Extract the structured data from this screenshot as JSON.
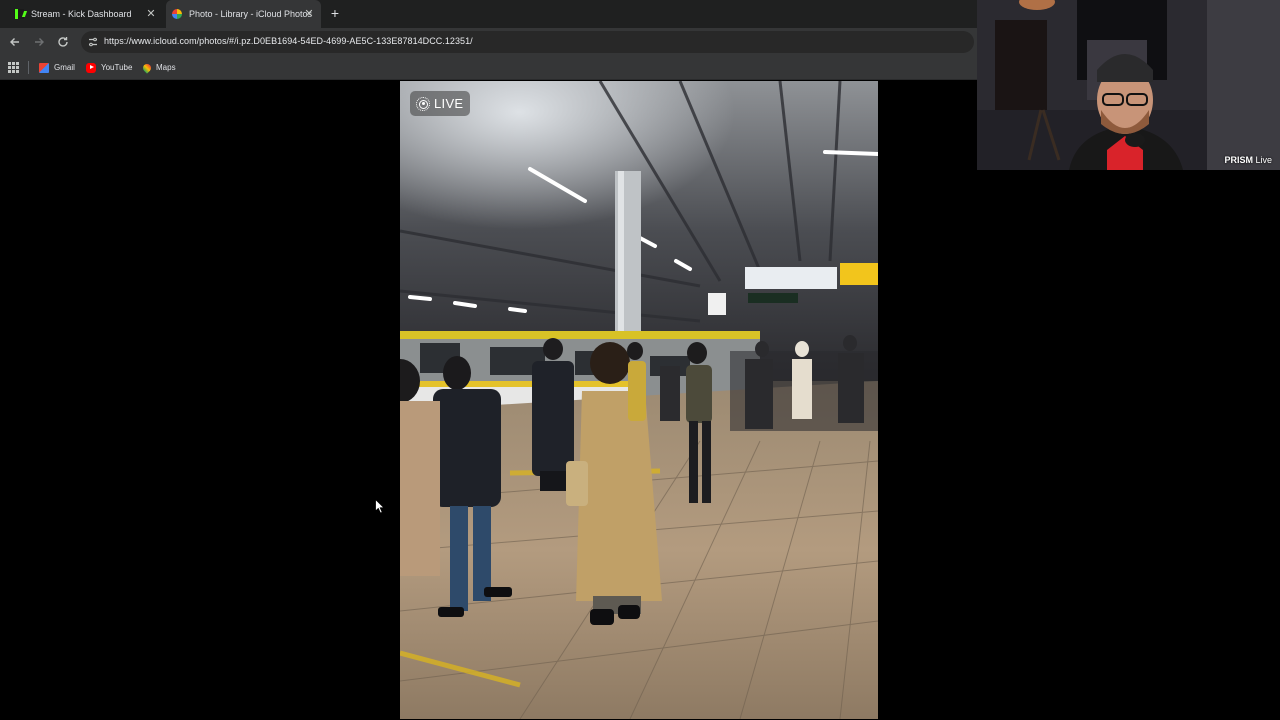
{
  "browser": {
    "tabs": [
      {
        "title": "Stream - Kick Dashboard",
        "favicon": "kick-icon",
        "active": false
      },
      {
        "title": "Photo - Library - iCloud Photos",
        "favicon": "photos-icon",
        "active": true
      }
    ],
    "new_tab_icon": "plus-icon",
    "address": {
      "url": "https://www.icloud.com/photos/#/i.pz.D0EB1694-54ED-4699-AE5C-133E87814DCC.12351/"
    },
    "bookmarks": [
      {
        "label": "Gmail",
        "icon": "gmail-icon"
      },
      {
        "label": "YouTube",
        "icon": "youtube-icon"
      },
      {
        "label": "Maps",
        "icon": "maps-icon"
      }
    ]
  },
  "viewer": {
    "live_label": "LIVE"
  },
  "webcam": {
    "brand": "PRISM",
    "suffix": "Live"
  },
  "colors": {
    "page_bg": "#000000",
    "tabstrip_bg": "#1f2020",
    "toolbar_bg": "#353637",
    "omnibox_bg": "#282828",
    "kick_green": "#53fc18"
  }
}
